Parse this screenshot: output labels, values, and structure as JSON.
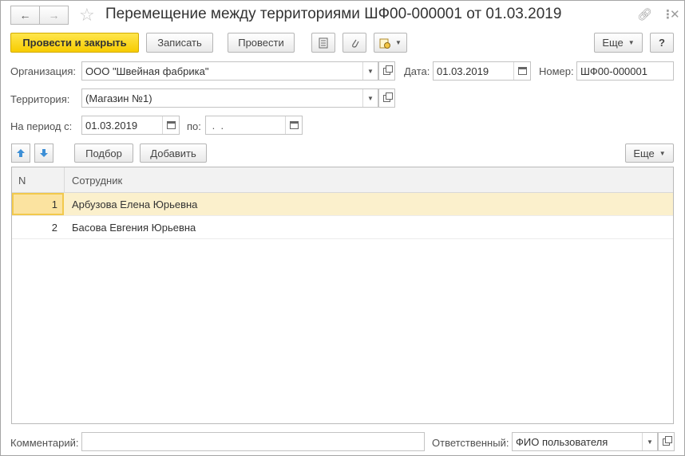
{
  "window": {
    "title": "Перемещение между территориями ШФ00-000001 от 01.03.2019",
    "back_icon": "arrow-left-icon",
    "forward_icon": "arrow-right-icon",
    "favorite_icon": "star-icon",
    "link_icon": "link-icon",
    "more_icon": "kebab-icon",
    "close_icon": "close-icon"
  },
  "toolbar": {
    "post_and_close": "Провести и закрыть",
    "save": "Записать",
    "post": "Провести",
    "more": "Еще",
    "help": "?"
  },
  "form": {
    "organization": {
      "label": "Организация:",
      "value": "ООО \"Швейная фабрика\""
    },
    "date": {
      "label": "Дата:",
      "value": "01.03.2019"
    },
    "number": {
      "label": "Номер:",
      "value": "ШФ00-000001"
    },
    "territory": {
      "label": "Территория:",
      "value": "(Магазин №1)"
    },
    "period_from": {
      "label": "На период с:",
      "value": "01.03.2019"
    },
    "period_to": {
      "label": "по:",
      "value": " .  ."
    }
  },
  "table_toolbar": {
    "select": "Подбор",
    "add": "Добавить",
    "more": "Еще"
  },
  "table": {
    "columns": [
      "N",
      "Сотрудник"
    ],
    "rows": [
      {
        "n": "1",
        "employee": "Арбузова Елена Юрьевна",
        "selected": true
      },
      {
        "n": "2",
        "employee": "Басова Евгения Юрьевна",
        "selected": false
      }
    ]
  },
  "footer": {
    "comment_label": "Комментарий:",
    "comment_value": "",
    "responsible_label": "Ответственный:",
    "responsible_value": "ФИО пользователя"
  },
  "colors": {
    "primary_button": "#f7cc00",
    "selected_row": "#fbf0cc",
    "arrow_blue": "#3d8fd6"
  }
}
